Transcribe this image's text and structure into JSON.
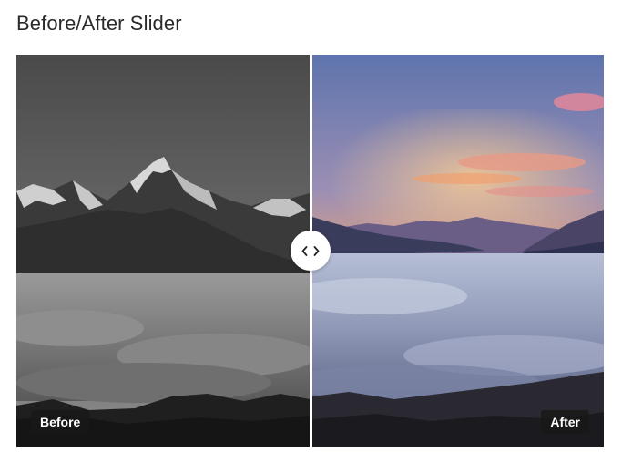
{
  "page": {
    "title": "Before/After Slider"
  },
  "slider": {
    "before_label": "Before",
    "after_label": "After",
    "position": 0.5,
    "handle_icon": "left-right-chevrons-icon"
  },
  "colors": {
    "divider": "#ffffff",
    "label_bg": "#191919",
    "label_text": "#ffffff",
    "sky_top": "#6a7fb3",
    "sunset_glow": "#f4a46c"
  }
}
